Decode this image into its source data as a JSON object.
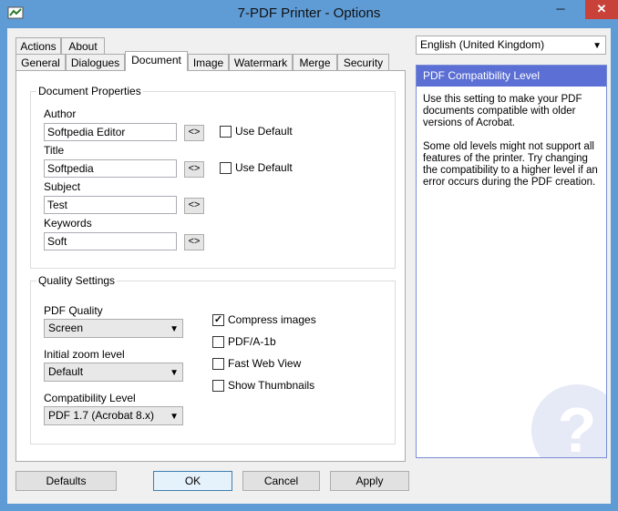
{
  "window": {
    "title": "7-PDF Printer - Options",
    "minimize": "─",
    "maximize": "□",
    "close": "✕"
  },
  "tabs": {
    "row1": [
      "Actions",
      "About"
    ],
    "row2": [
      "General",
      "Dialogues",
      "Document",
      "Image",
      "Watermark",
      "Merge",
      "Security"
    ],
    "active": "Document"
  },
  "document_properties": {
    "title": "Document Properties",
    "author_label": "Author",
    "author_value": "Softpedia Editor",
    "title_label": "Title",
    "title_value": "Softpedia",
    "subject_label": "Subject",
    "subject_value": "Test",
    "keywords_label": "Keywords",
    "keywords_value": "Soft",
    "swap_button": "<>",
    "use_default_label": "Use Default"
  },
  "quality_settings": {
    "title": "Quality Settings",
    "pdf_quality_label": "PDF Quality",
    "pdf_quality_value": "Screen",
    "zoom_label": "Initial zoom level",
    "zoom_value": "Default",
    "compat_label": "Compatibility Level",
    "compat_value": "PDF 1.7 (Acrobat 8.x)",
    "compress_images": "Compress images",
    "pdfa": "PDF/A-1b",
    "fast_web_view": "Fast Web View",
    "show_thumbnails": "Show Thumbnails"
  },
  "language": {
    "selected": "English (United Kingdom)"
  },
  "help": {
    "title": "PDF Compatibility Level",
    "para1": "Use this setting to make your PDF documents compatible with older versions of Acrobat.",
    "para2": "Some old levels might not support all features of the printer. Try changing the compatibility to a higher level if an error occurs during the PDF creation.",
    "icon_glyph": "?"
  },
  "buttons": {
    "defaults": "Defaults",
    "ok": "OK",
    "cancel": "Cancel",
    "apply": "Apply"
  },
  "colors": {
    "frame": "#5f9cd6",
    "close": "#c8423a",
    "help_header": "#5b6fd4"
  }
}
